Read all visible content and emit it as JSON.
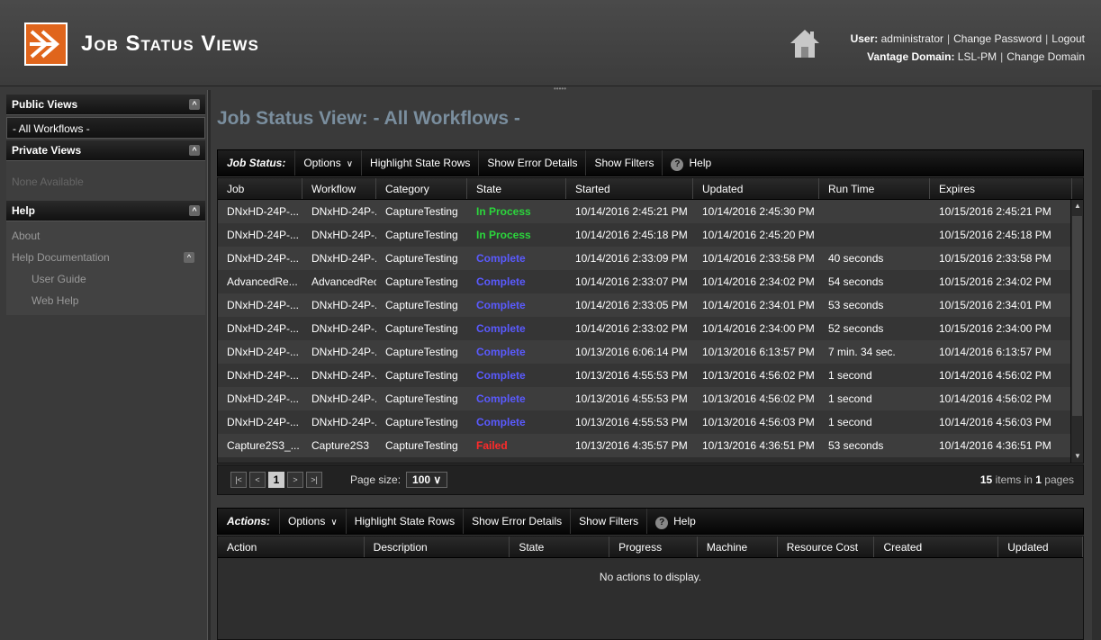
{
  "header": {
    "title": "Job Status Views",
    "user_label": "User:",
    "user_name": "administrator",
    "change_password": "Change Password",
    "logout": "Logout",
    "domain_label": "Vantage Domain:",
    "domain_name": "LSL-PM",
    "change_domain": "Change Domain"
  },
  "sidebar": {
    "public_views": "Public Views",
    "public_items": [
      "- All Workflows -"
    ],
    "private_views": "Private Views",
    "private_none": "None Available",
    "help": "Help",
    "about": "About",
    "help_documentation": "Help Documentation",
    "user_guide": "User Guide",
    "web_help": "Web Help"
  },
  "main": {
    "title": "Job Status View: - All Workflows -"
  },
  "job_toolbar": {
    "label": "Job Status:",
    "options": "Options",
    "highlight": "Highlight State Rows",
    "errors": "Show Error Details",
    "filters": "Show Filters",
    "help": "Help"
  },
  "job_grid": {
    "columns": [
      "Job",
      "Workflow",
      "Category",
      "State",
      "Started",
      "Updated",
      "Run Time",
      "Expires"
    ],
    "rows": [
      [
        "DNxHD-24P-...",
        "DNxHD-24P-...",
        "CaptureTesting",
        "In Process",
        "10/14/2016 2:45:21 PM",
        "10/14/2016 2:45:30 PM",
        "",
        "10/15/2016 2:45:21 PM"
      ],
      [
        "DNxHD-24P-...",
        "DNxHD-24P-...",
        "CaptureTesting",
        "In Process",
        "10/14/2016 2:45:18 PM",
        "10/14/2016 2:45:20 PM",
        "",
        "10/15/2016 2:45:18 PM"
      ],
      [
        "DNxHD-24P-...",
        "DNxHD-24P-...",
        "CaptureTesting",
        "Complete",
        "10/14/2016 2:33:09 PM",
        "10/14/2016 2:33:58 PM",
        "40 seconds",
        "10/15/2016 2:33:58 PM"
      ],
      [
        "AdvancedRe...",
        "AdvancedRec...",
        "CaptureTesting",
        "Complete",
        "10/14/2016 2:33:07 PM",
        "10/14/2016 2:34:02 PM",
        "54 seconds",
        "10/15/2016 2:34:02 PM"
      ],
      [
        "DNxHD-24P-...",
        "DNxHD-24P-...",
        "CaptureTesting",
        "Complete",
        "10/14/2016 2:33:05 PM",
        "10/14/2016 2:34:01 PM",
        "53 seconds",
        "10/15/2016 2:34:01 PM"
      ],
      [
        "DNxHD-24P-...",
        "DNxHD-24P-...",
        "CaptureTesting",
        "Complete",
        "10/14/2016 2:33:02 PM",
        "10/14/2016 2:34:00 PM",
        "52 seconds",
        "10/15/2016 2:34:00 PM"
      ],
      [
        "DNxHD-24P-...",
        "DNxHD-24P-...",
        "CaptureTesting",
        "Complete",
        "10/13/2016 6:06:14 PM",
        "10/13/2016 6:13:57 PM",
        "7 min. 34 sec.",
        "10/14/2016 6:13:57 PM"
      ],
      [
        "DNxHD-24P-...",
        "DNxHD-24P-...",
        "CaptureTesting",
        "Complete",
        "10/13/2016 4:55:53 PM",
        "10/13/2016 4:56:02 PM",
        "1 second",
        "10/14/2016 4:56:02 PM"
      ],
      [
        "DNxHD-24P-...",
        "DNxHD-24P-...",
        "CaptureTesting",
        "Complete",
        "10/13/2016 4:55:53 PM",
        "10/13/2016 4:56:02 PM",
        "1 second",
        "10/14/2016 4:56:02 PM"
      ],
      [
        "DNxHD-24P-...",
        "DNxHD-24P-...",
        "CaptureTesting",
        "Complete",
        "10/13/2016 4:55:53 PM",
        "10/13/2016 4:56:03 PM",
        "1 second",
        "10/14/2016 4:56:03 PM"
      ],
      [
        "Capture2S3_...",
        "Capture2S3",
        "CaptureTesting",
        "Failed",
        "10/13/2016 4:35:57 PM",
        "10/13/2016 4:36:51 PM",
        "53 seconds",
        "10/14/2016 4:36:51 PM"
      ]
    ]
  },
  "pager": {
    "current_page": "1",
    "page_size_label": "Page size:",
    "page_size": "100",
    "items_count": "15",
    "items_text": "items in",
    "pages_count": "1",
    "pages_text": "pages"
  },
  "actions_toolbar": {
    "label": "Actions:",
    "options": "Options",
    "highlight": "Highlight State Rows",
    "errors": "Show Error Details",
    "filters": "Show Filters",
    "help": "Help"
  },
  "actions_grid": {
    "columns": [
      "Action",
      "Description",
      "State",
      "Progress",
      "Machine",
      "Resource Cost",
      "Created",
      "Updated"
    ],
    "empty": "No actions to display."
  },
  "colors": {
    "in_process": "#2bd63c",
    "complete": "#5a5aff",
    "failed": "#ff2a2a",
    "logo": "#e0651c",
    "title": "#7a8e9e"
  }
}
